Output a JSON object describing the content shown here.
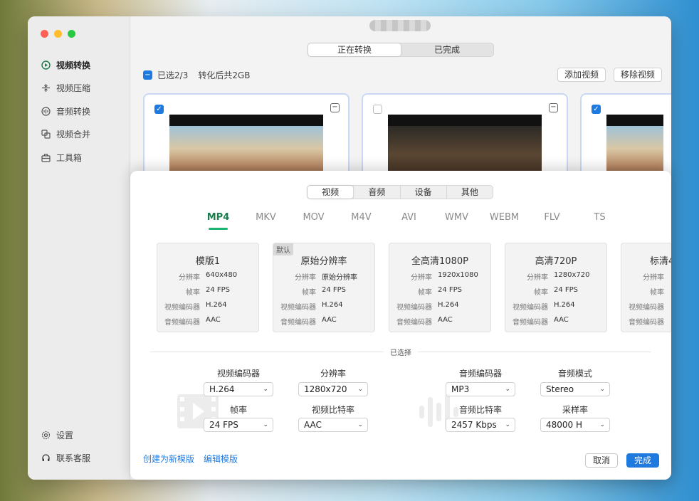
{
  "sidebar": {
    "items": [
      {
        "label": "视频转换",
        "icon": "video-convert-icon",
        "active": true
      },
      {
        "label": "视频压缩",
        "icon": "compress-icon",
        "active": false
      },
      {
        "label": "音频转换",
        "icon": "audio-convert-icon",
        "active": false
      },
      {
        "label": "视频合并",
        "icon": "merge-icon",
        "active": false
      },
      {
        "label": "工具箱",
        "icon": "toolbox-icon",
        "active": false
      }
    ],
    "bottom": [
      {
        "label": "设置",
        "icon": "gear-icon"
      },
      {
        "label": "联系客服",
        "icon": "headset-icon"
      }
    ]
  },
  "top_tabs": [
    "正在转换",
    "已完成"
  ],
  "selection": {
    "count": "已选2/3",
    "size": "转化后共2GB"
  },
  "toolbar": {
    "add": "添加视频",
    "remove": "移除视频"
  },
  "category_tabs": [
    "视频",
    "音频",
    "设备",
    "其他"
  ],
  "formats": [
    "MP4",
    "MKV",
    "MOV",
    "M4V",
    "AVI",
    "WMV",
    "WEBM",
    "FLV",
    "TS"
  ],
  "presets": [
    {
      "name": "模版1",
      "tag": "",
      "resolution": "640x480",
      "fps": "24 FPS",
      "vcodec": "H.264",
      "acodec": "AAC"
    },
    {
      "name": "原始分辨率",
      "tag": "默认",
      "resolution": "原始分辨率",
      "fps": "24 FPS",
      "vcodec": "H.264",
      "acodec": "AAC"
    },
    {
      "name": "全高清1080P",
      "tag": "",
      "resolution": "1920x1080",
      "fps": "24 FPS",
      "vcodec": "H.264",
      "acodec": "AAC"
    },
    {
      "name": "高清720P",
      "tag": "",
      "resolution": "1280x720",
      "fps": "24 FPS",
      "vcodec": "H.264",
      "acodec": "AAC"
    },
    {
      "name": "标清4",
      "tag": "",
      "resolution": "",
      "fps": "",
      "vcodec": "",
      "acodec": ""
    }
  ],
  "preset_keys": {
    "resolution": "分辨率",
    "fps": "帧率",
    "vcodec": "视频编码器",
    "acodec": "音频编码器"
  },
  "selected_label": "已选择",
  "fields": {
    "vcodec": {
      "label": "视频编码器",
      "value": "H.264"
    },
    "resolution": {
      "label": "分辨率",
      "value": "1280x720"
    },
    "fps": {
      "label": "帧率",
      "value": "24 FPS"
    },
    "vbitrate": {
      "label": "视频比特率",
      "value": "AAC"
    },
    "acodec": {
      "label": "音频编码器",
      "value": "MP3"
    },
    "amode": {
      "label": "音频模式",
      "value": "Stereo"
    },
    "abitrate": {
      "label": "音频比特率",
      "value": "2457 Kbps"
    },
    "samplerate": {
      "label": "采样率",
      "value": "48000 H"
    }
  },
  "links": {
    "create": "创建为新模版",
    "edit": "编辑模版"
  },
  "buttons": {
    "cancel": "取消",
    "ok": "完成"
  },
  "colors": {
    "accent": "#1a7b4c",
    "primary": "#1f7ae0"
  }
}
